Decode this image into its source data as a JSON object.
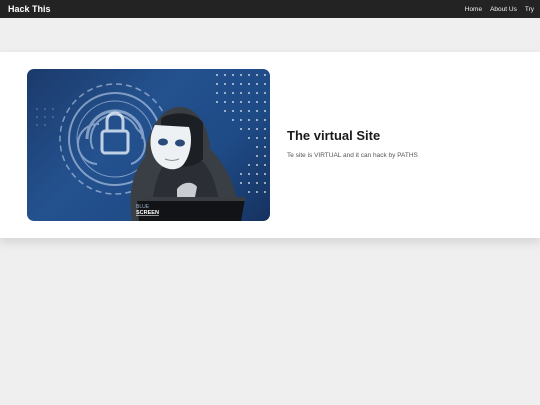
{
  "navbar": {
    "brand": "Hack This",
    "links": [
      {
        "label": "Home"
      },
      {
        "label": "About Us"
      },
      {
        "label": "Try"
      }
    ]
  },
  "hero": {
    "title": "The virtual Site",
    "description": "Te site is VIRTUAL and it can hack by PATHS",
    "image_watermark_line1": "BLUE",
    "image_watermark_line2": "SCREEN"
  },
  "colors": {
    "navbar_bg": "#232323",
    "page_bg": "#efefef",
    "card_bg": "#ffffff",
    "image_blue": "#1e4a85"
  },
  "icons": [
    "lock-icon",
    "fingerprint-icon"
  ]
}
